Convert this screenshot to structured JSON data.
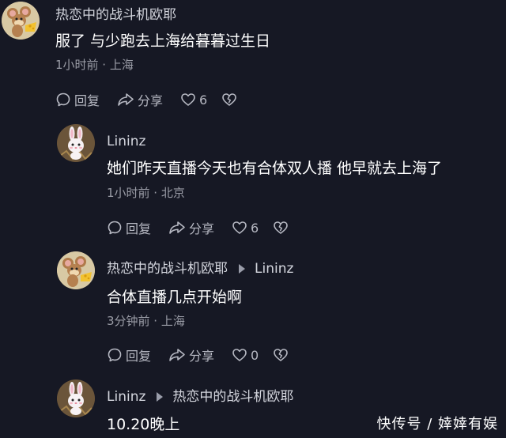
{
  "comments": [
    {
      "avatar": "jerry-mouse-avatar",
      "user": "热恋中的战斗机欧耶",
      "reply_to": "",
      "text": "服了 与少跑去上海给暮暮过生日",
      "meta": "1小时前 · 上海",
      "reply_label": "回复",
      "share_label": "分享",
      "likes": "6"
    },
    {
      "avatar": "bunny-avatar",
      "user": "Lininz",
      "reply_to": "",
      "text": "她们昨天直播今天也有合体双人播 他早就去上海了",
      "meta": "1小时前 · 北京",
      "reply_label": "回复",
      "share_label": "分享",
      "likes": "6"
    },
    {
      "avatar": "jerry-mouse-avatar",
      "user": "热恋中的战斗机欧耶",
      "reply_to": "Lininz",
      "text": "合体直播几点开始啊",
      "meta": "3分钟前 · 上海",
      "reply_label": "回复",
      "share_label": "分享",
      "likes": "0"
    },
    {
      "avatar": "bunny-avatar",
      "user": "Lininz",
      "reply_to": "热恋中的战斗机欧耶",
      "text": "10.20晚上",
      "meta": "",
      "reply_label": "",
      "share_label": "",
      "likes": ""
    }
  ],
  "watermark": "快传号 / 婞婞有娱",
  "colors": {
    "background": "#161824",
    "meta": "#9a9ca6",
    "action": "#b6b8c2"
  }
}
